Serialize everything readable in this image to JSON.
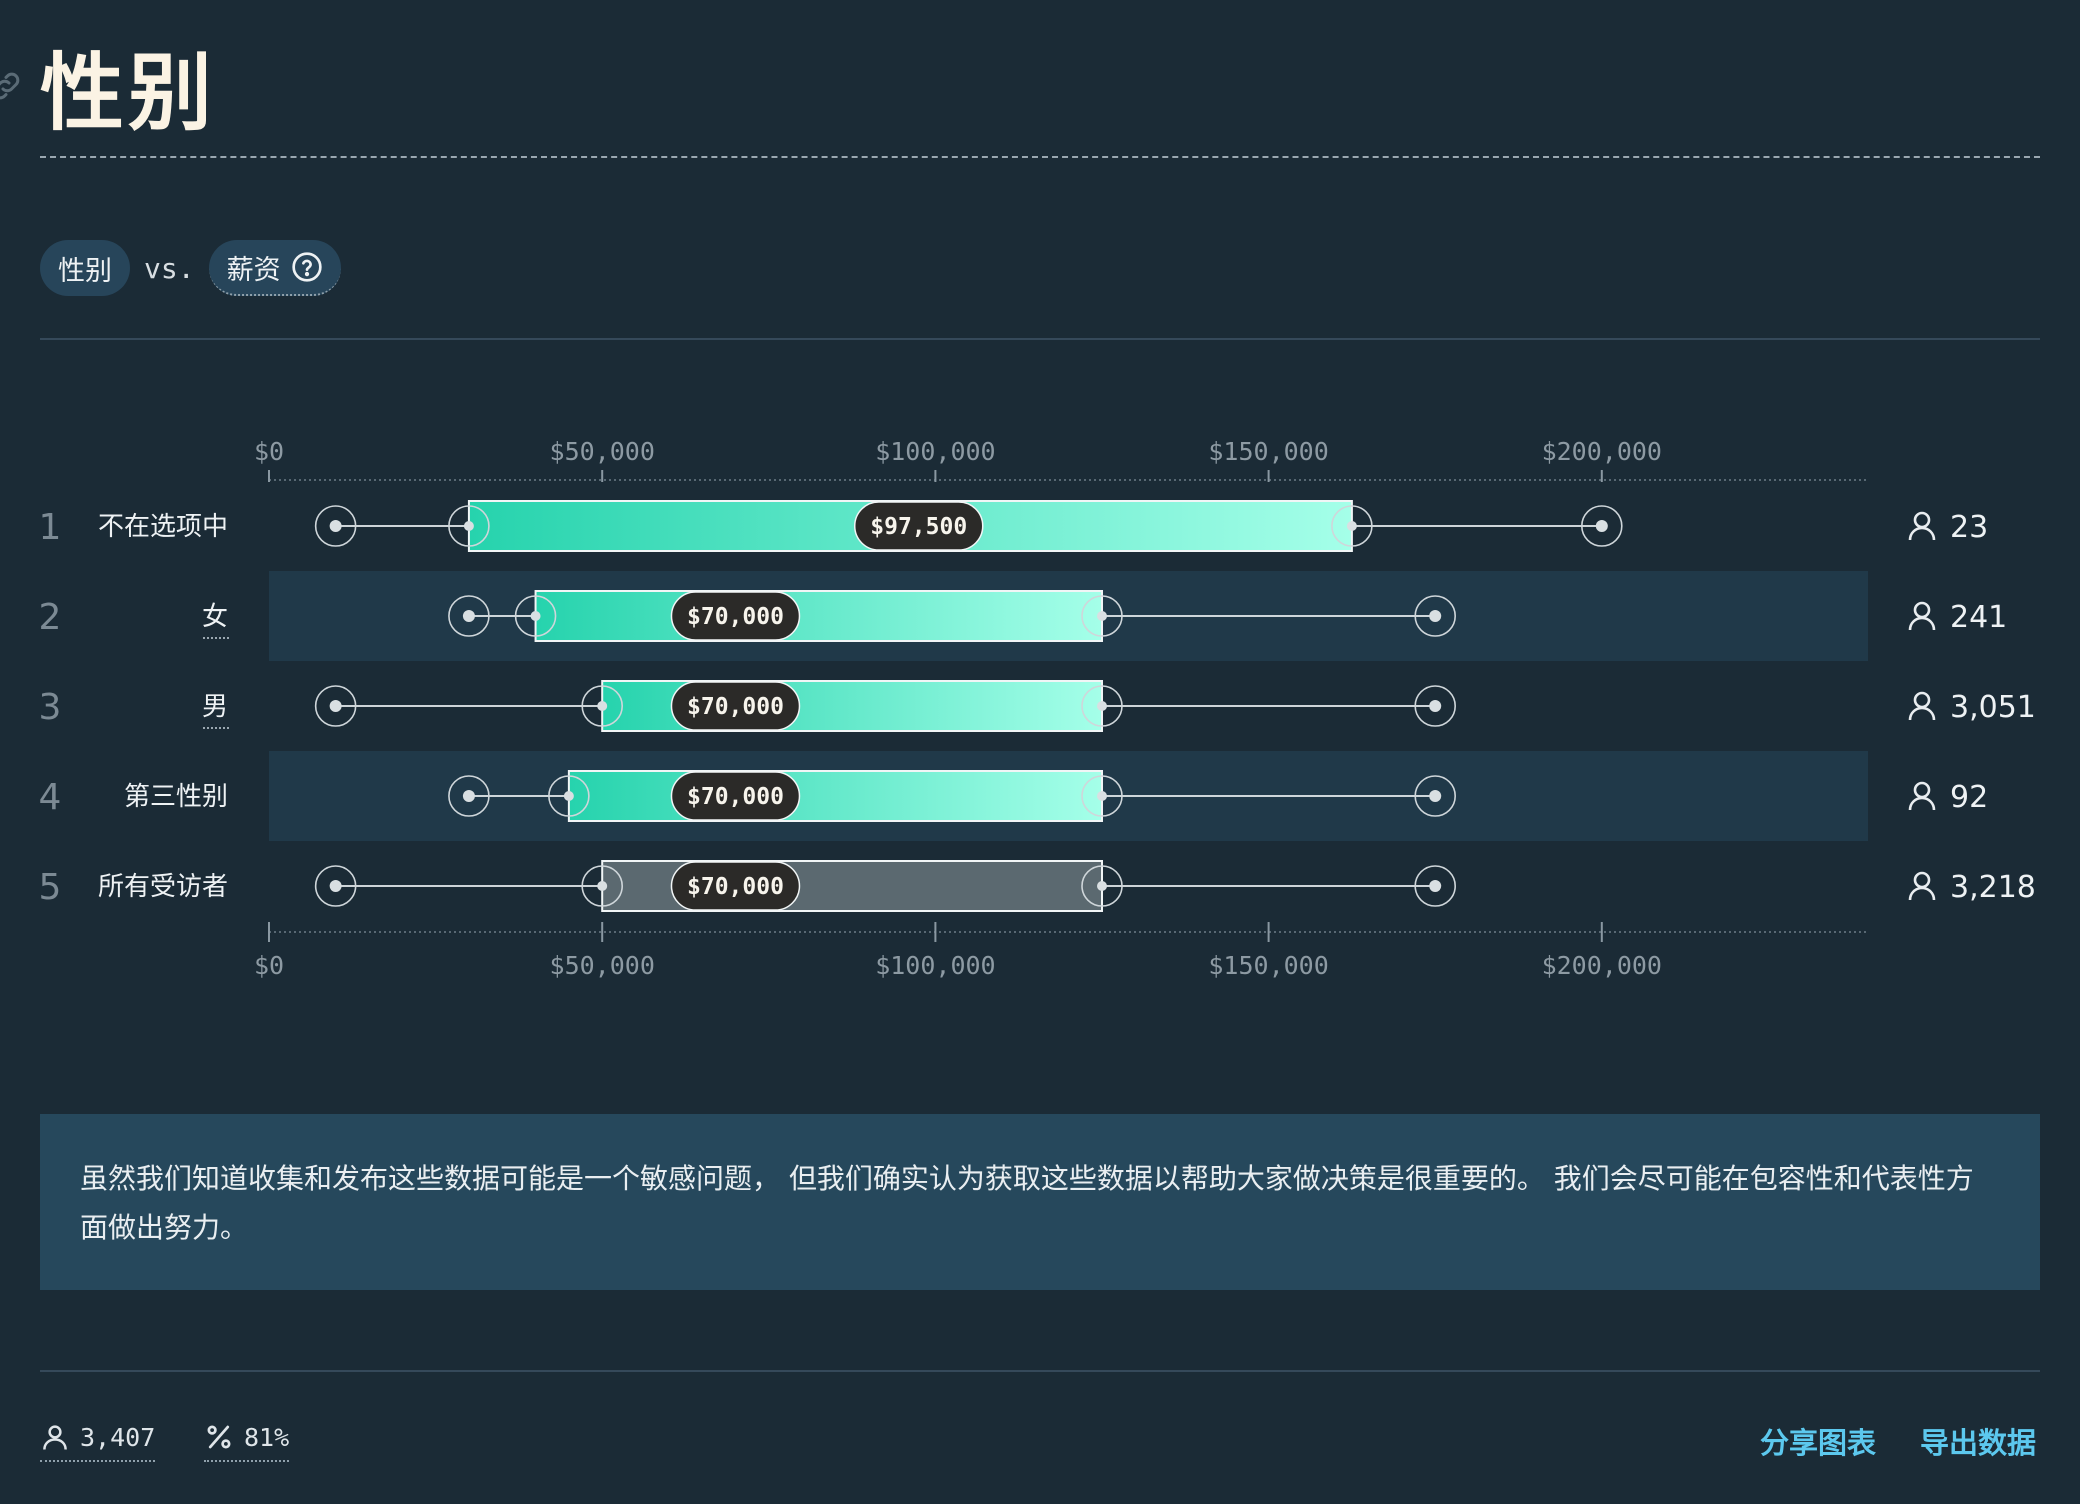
{
  "header": {
    "title": "性别",
    "link_icon": "link-icon"
  },
  "filters": {
    "left_pill": "性别",
    "vs": "vs.",
    "right_pill": "薪资",
    "help_icon": "question-circle-icon"
  },
  "chart_data": {
    "type": "boxplot",
    "x_ticks": [
      "$0",
      "$50,000",
      "$100,000",
      "$150,000",
      "$200,000"
    ],
    "x_range": [
      0,
      240000
    ],
    "rows": [
      {
        "rank": "1",
        "label": "不在选项中",
        "min": 10000,
        "q1": 30000,
        "median": 97500,
        "median_label": "$97,500",
        "q3": 162500,
        "max": 200000,
        "count": "23",
        "type": "category"
      },
      {
        "rank": "2",
        "label": "女",
        "min": 30000,
        "q1": 40000,
        "median": 70000,
        "median_label": "$70,000",
        "q3": 125000,
        "max": 175000,
        "count": "241",
        "type": "category"
      },
      {
        "rank": "3",
        "label": "男",
        "min": 10000,
        "q1": 50000,
        "median": 70000,
        "median_label": "$70,000",
        "q3": 125000,
        "max": 175000,
        "count": "3,051",
        "type": "category"
      },
      {
        "rank": "4",
        "label": "第三性别",
        "min": 30000,
        "q1": 45000,
        "median": 70000,
        "median_label": "$70,000",
        "q3": 125000,
        "max": 175000,
        "count": "92",
        "type": "category"
      },
      {
        "rank": "5",
        "label": "所有受访者",
        "min": 10000,
        "q1": 50000,
        "median": 70000,
        "median_label": "$70,000",
        "q3": 125000,
        "max": 175000,
        "count": "3,218",
        "type": "total"
      }
    ],
    "colors": {
      "bar_start": "#26d3ad",
      "bar_end": "#a5ffe9",
      "total_bar": "#5b6970",
      "stripe": "#203949",
      "median_pill": "#2b2a28"
    },
    "count_icon": "person-icon"
  },
  "note": {
    "text": "虽然我们知道收集和发布这些数据可能是一个敏感问题， 但我们确实认为获取这些数据以帮助大家做决策是很重要的。 我们会尽可能在包容性和代表性方面做出努力。"
  },
  "footer": {
    "respondents": "3,407",
    "respondents_icon": "person-icon",
    "percent": "81%",
    "percent_icon": "percent-icon",
    "share_label": "分享图表",
    "export_label": "导出数据"
  }
}
